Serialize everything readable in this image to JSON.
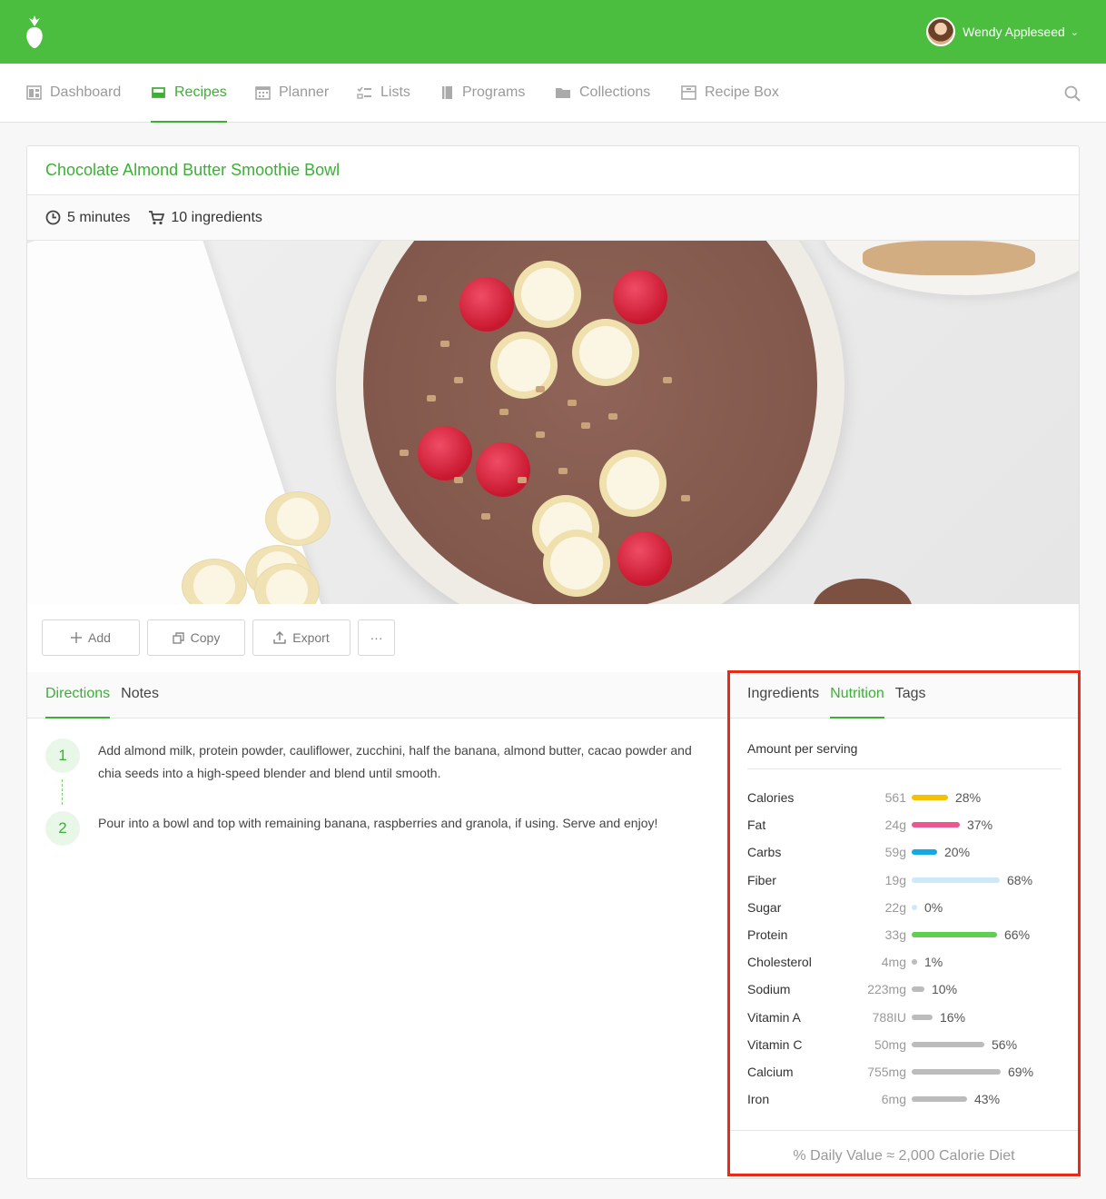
{
  "user": {
    "name": "Wendy Appleseed"
  },
  "nav": {
    "items": [
      {
        "label": "Dashboard",
        "icon": "dashboard-icon",
        "active": false
      },
      {
        "label": "Recipes",
        "icon": "recipes-icon",
        "active": true
      },
      {
        "label": "Planner",
        "icon": "calendar-icon",
        "active": false
      },
      {
        "label": "Lists",
        "icon": "checklist-icon",
        "active": false
      },
      {
        "label": "Programs",
        "icon": "book-icon",
        "active": false
      },
      {
        "label": "Collections",
        "icon": "folder-icon",
        "active": false
      },
      {
        "label": "Recipe Box",
        "icon": "box-icon",
        "active": false
      }
    ]
  },
  "recipe": {
    "title": "Chocolate Almond Butter Smoothie Bowl",
    "time": "5 minutes",
    "ingredients_count": "10 ingredients"
  },
  "actions": {
    "add": "Add",
    "copy": "Copy",
    "export": "Export",
    "more": "···"
  },
  "directions": {
    "tabs": [
      "Directions",
      "Notes"
    ],
    "steps": [
      {
        "num": "1",
        "text": "Add almond milk, protein powder, cauliflower, zucchini, half the banana, almond butter, cacao powder and chia seeds into a high-speed blender and blend until smooth."
      },
      {
        "num": "2",
        "text": "Pour into a bowl and top with remaining banana, raspberries and granola, if using. Serve and enjoy!"
      }
    ]
  },
  "nutrition": {
    "tabs": [
      "Ingredients",
      "Nutrition",
      "Tags"
    ],
    "amount_label": "Amount per serving",
    "rows": [
      {
        "label": "Calories",
        "value": "561",
        "pct": "28%",
        "pct_num": 28,
        "color": "#f5c000"
      },
      {
        "label": "Fat",
        "value": "24g",
        "pct": "37%",
        "pct_num": 37,
        "color": "#e9588f"
      },
      {
        "label": "Carbs",
        "value": "59g",
        "pct": "20%",
        "pct_num": 20,
        "color": "#15a8e6"
      },
      {
        "label": "Fiber",
        "value": "19g",
        "pct": "68%",
        "pct_num": 68,
        "color": "#cde9f9"
      },
      {
        "label": "Sugar",
        "value": "22g",
        "pct": "0%",
        "pct_num": 0,
        "color": "#cde9f9"
      },
      {
        "label": "Protein",
        "value": "33g",
        "pct": "66%",
        "pct_num": 66,
        "color": "#5ecf4f"
      },
      {
        "label": "Cholesterol",
        "value": "4mg",
        "pct": "1%",
        "pct_num": 1,
        "color": "#bcbcbc"
      },
      {
        "label": "Sodium",
        "value": "223mg",
        "pct": "10%",
        "pct_num": 10,
        "color": "#bcbcbc"
      },
      {
        "label": "Vitamin A",
        "value": "788IU",
        "pct": "16%",
        "pct_num": 16,
        "color": "#bcbcbc"
      },
      {
        "label": "Vitamin C",
        "value": "50mg",
        "pct": "56%",
        "pct_num": 56,
        "color": "#bcbcbc"
      },
      {
        "label": "Calcium",
        "value": "755mg",
        "pct": "69%",
        "pct_num": 69,
        "color": "#bcbcbc"
      },
      {
        "label": "Iron",
        "value": "6mg",
        "pct": "43%",
        "pct_num": 43,
        "color": "#bcbcbc"
      }
    ],
    "footer": "% Daily Value ≈ 2,000 Calorie Diet"
  },
  "colors": {
    "brand": "#4cbe3f",
    "accent": "#3cb035",
    "highlight": "#e82a17"
  }
}
